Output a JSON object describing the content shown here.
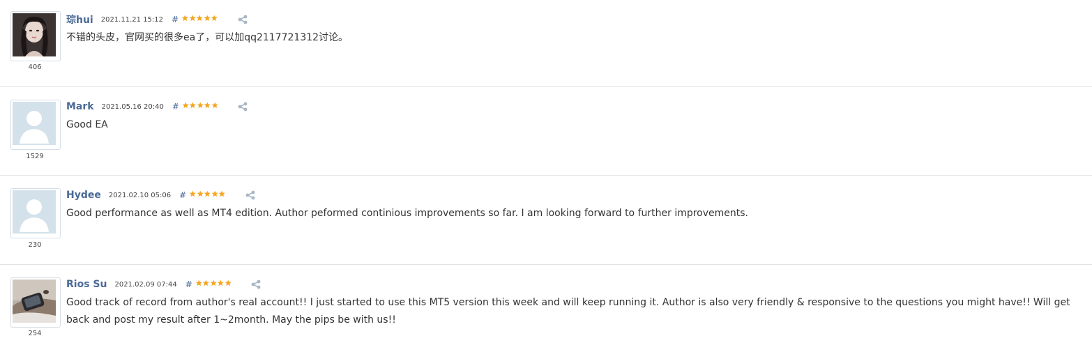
{
  "colors": {
    "author": "#4a6a96",
    "star": "#f5a623",
    "divider": "#e3e3e3",
    "text": "#333333"
  },
  "reviews": [
    {
      "author": "琮hui",
      "date": "2021.11.21 15:12",
      "hash": "#",
      "stars": 5,
      "rating_count": "406",
      "avatar": "photo-woman-icon",
      "text": "不错的头皮，官网买的很多ea了，可以加qq2117721312讨论。"
    },
    {
      "author": "Mark",
      "date": "2021.05.16 20:40",
      "hash": "#",
      "stars": 5,
      "rating_count": "1529",
      "avatar": "default-user-icon",
      "text": "Good EA"
    },
    {
      "author": "Hydee",
      "date": "2021.02.10 05:06",
      "hash": "#",
      "stars": 5,
      "rating_count": "230",
      "avatar": "default-user-icon",
      "text": "Good performance as well as MT4 edition. Author peformed continious improvements so far. I am looking forward to further improvements."
    },
    {
      "author": "Rios Su",
      "date": "2021.02.09 07:44",
      "hash": "#",
      "stars": 5,
      "rating_count": "254",
      "avatar": "photo-hand-icon",
      "text": "Good track of record from author's real account!! I just started to use this MT5 version this week and will keep running it. Author is also very friendly & responsive to the questions you might have!! Will get back and post my result after 1~2month. May the pips be with us!!"
    }
  ]
}
